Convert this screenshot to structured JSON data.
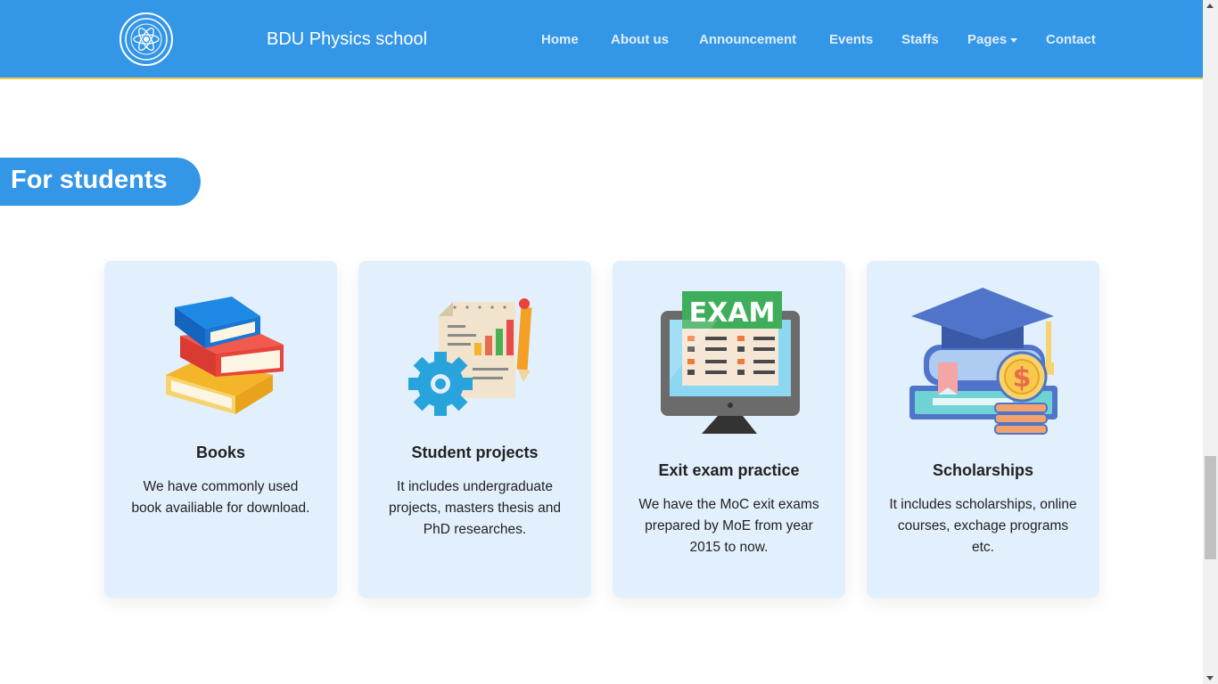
{
  "navbar": {
    "logo_icon": "university-seal-icon",
    "brand": "BDU Physics school",
    "items": [
      {
        "label": "Home"
      },
      {
        "label": "About us"
      },
      {
        "label": "Announcement"
      },
      {
        "label": "Events"
      },
      {
        "label": "Staffs"
      },
      {
        "label": "Pages"
      },
      {
        "label": "Contact"
      }
    ]
  },
  "section": {
    "title": "For students"
  },
  "cards": [
    {
      "icon": "books-stack-icon",
      "title": "Books",
      "description": "We have commonly used book availiable for download."
    },
    {
      "icon": "project-report-icon",
      "title": "Student projects",
      "description": "It includes undergraduate projects, masters thesis and PhD researches."
    },
    {
      "icon": "exam-monitor-icon",
      "title": "Exit exam practice",
      "description": "We have the MoC exit exams prepared by MoE from year 2015 to now.",
      "icon_label": "EXAM"
    },
    {
      "icon": "graduation-scholarship-icon",
      "title": "Scholarships",
      "description": "It includes scholarships, online courses, exchage programs etc.",
      "icon_label": "$"
    }
  ],
  "colors": {
    "primary": "#3396e6",
    "card_bg": "#e1f0fc",
    "accent_border": "#f2c94c"
  }
}
